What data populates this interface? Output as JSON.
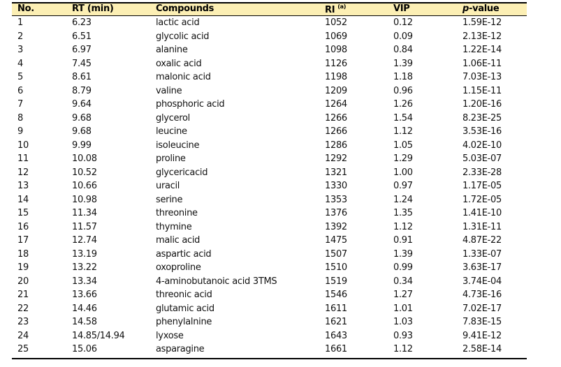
{
  "table": {
    "headers": {
      "no": "No.",
      "rt": "RT (min)",
      "compounds": "Compounds",
      "ri": "RI",
      "ri_note": "(a)",
      "vip": "VIP",
      "p_italic": "p",
      "p_rest": "-value"
    },
    "rows": [
      [
        "1",
        "6.23",
        "lactic acid",
        "1052",
        "0.12",
        "1.59E-12"
      ],
      [
        "2",
        "6.51",
        "glycolic acid",
        "1069",
        "0.09",
        "2.13E-12"
      ],
      [
        "3",
        "6.97",
        "alanine",
        "1098",
        "0.84",
        "1.22E-14"
      ],
      [
        "4",
        "7.45",
        "oxalic acid",
        "1126",
        "1.39",
        "1.06E-11"
      ],
      [
        "5",
        "8.61",
        "malonic acid",
        "1198",
        "1.18",
        "7.03E-13"
      ],
      [
        "6",
        "8.79",
        "valine",
        "1209",
        "0.96",
        "1.15E-11"
      ],
      [
        "7",
        "9.64",
        "phosphoric acid",
        "1264",
        "1.26",
        "1.20E-16"
      ],
      [
        "8",
        "9.68",
        "glycerol",
        "1266",
        "1.54",
        "8.23E-25"
      ],
      [
        "9",
        "9.68",
        "leucine",
        "1266",
        "1.12",
        "3.53E-16"
      ],
      [
        "10",
        "9.99",
        "isoleucine",
        "1286",
        "1.05",
        "4.02E-10"
      ],
      [
        "11",
        "10.08",
        "proline",
        "1292",
        "1.29",
        "5.03E-07"
      ],
      [
        "12",
        "10.52",
        "glycericacid",
        "1321",
        "1.00",
        "2.33E-28"
      ],
      [
        "13",
        "10.66",
        "uracil",
        "1330",
        "0.97",
        "1.17E-05"
      ],
      [
        "14",
        "10.98",
        "serine",
        "1353",
        "1.24",
        "1.72E-05"
      ],
      [
        "15",
        "11.34",
        "threonine",
        "1376",
        "1.35",
        "1.41E-10"
      ],
      [
        "16",
        "11.57",
        "thymine",
        "1392",
        "1.12",
        "1.31E-11"
      ],
      [
        "17",
        "12.74",
        "malic acid",
        "1475",
        "0.91",
        "4.87E-22"
      ],
      [
        "18",
        "13.19",
        "aspartic acid",
        "1507",
        "1.39",
        "1.33E-07"
      ],
      [
        "19",
        "13.22",
        "oxoproline",
        "1510",
        "0.99",
        "3.63E-17"
      ],
      [
        "20",
        "13.34",
        "4-aminobutanoic acid 3TMS",
        "1519",
        "0.34",
        "3.74E-04"
      ],
      [
        "21",
        "13.66",
        "threonic acid",
        "1546",
        "1.27",
        "4.73E-16"
      ],
      [
        "22",
        "14.46",
        "glutamic acid",
        "1611",
        "1.01",
        "7.02E-17"
      ],
      [
        "23",
        "14.58",
        "phenylalnine",
        "1621",
        "1.03",
        "7.83E-15"
      ],
      [
        "24",
        "14.85/14.94",
        "lyxose",
        "1643",
        "0.93",
        "9.41E-12"
      ],
      [
        "25",
        "15.06",
        "asparagine",
        "1661",
        "1.12",
        "2.58E-14"
      ]
    ],
    "header_bg": "#fcefb4"
  }
}
